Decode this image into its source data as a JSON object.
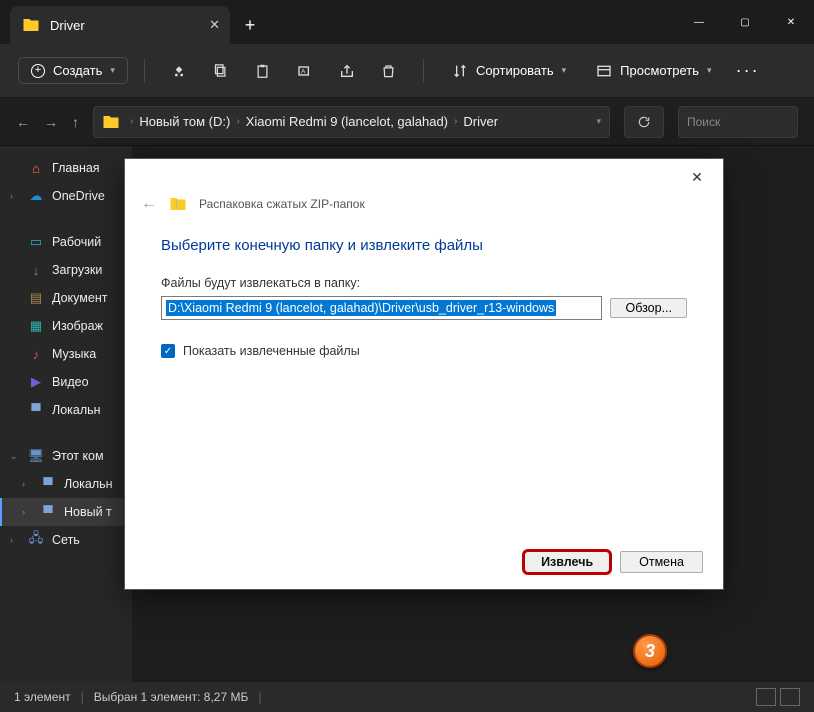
{
  "titlebar": {
    "tab_title": "Driver"
  },
  "toolbar": {
    "create": "Создать",
    "sort": "Сортировать",
    "view": "Просмотреть"
  },
  "breadcrumbs": {
    "root": "Новый том (D:)",
    "folder1": "Xiaomi Redmi 9 (lancelot, galahad)",
    "folder2": "Driver"
  },
  "search": {
    "placeholder": "Поиск"
  },
  "sidebar": {
    "home": "Главная",
    "onedrive": "OneDrive",
    "desktop": "Рабочий",
    "downloads": "Загрузки",
    "documents": "Документ",
    "images": "Изображ",
    "music": "Музыка",
    "video": "Видео",
    "local": "Локальн",
    "thispc": "Этот ком",
    "localn": "Локальн",
    "newvol": "Новый т",
    "network": "Сеть"
  },
  "status": {
    "count": "1 элемент",
    "selected": "Выбран 1 элемент: 8,27 МБ"
  },
  "dialog": {
    "header": "Распаковка сжатых ZIP-папок",
    "title": "Выберите конечную папку и извлеките файлы",
    "label": "Файлы будут извлекаться в папку:",
    "path": "D:\\Xiaomi Redmi 9 (lancelot, galahad)\\Driver\\usb_driver_r13-windows",
    "browse": "Обзор...",
    "checkbox": "Показать извлеченные файлы",
    "extract": "Извлечь",
    "cancel": "Отмена"
  },
  "marker": {
    "num": "3"
  }
}
